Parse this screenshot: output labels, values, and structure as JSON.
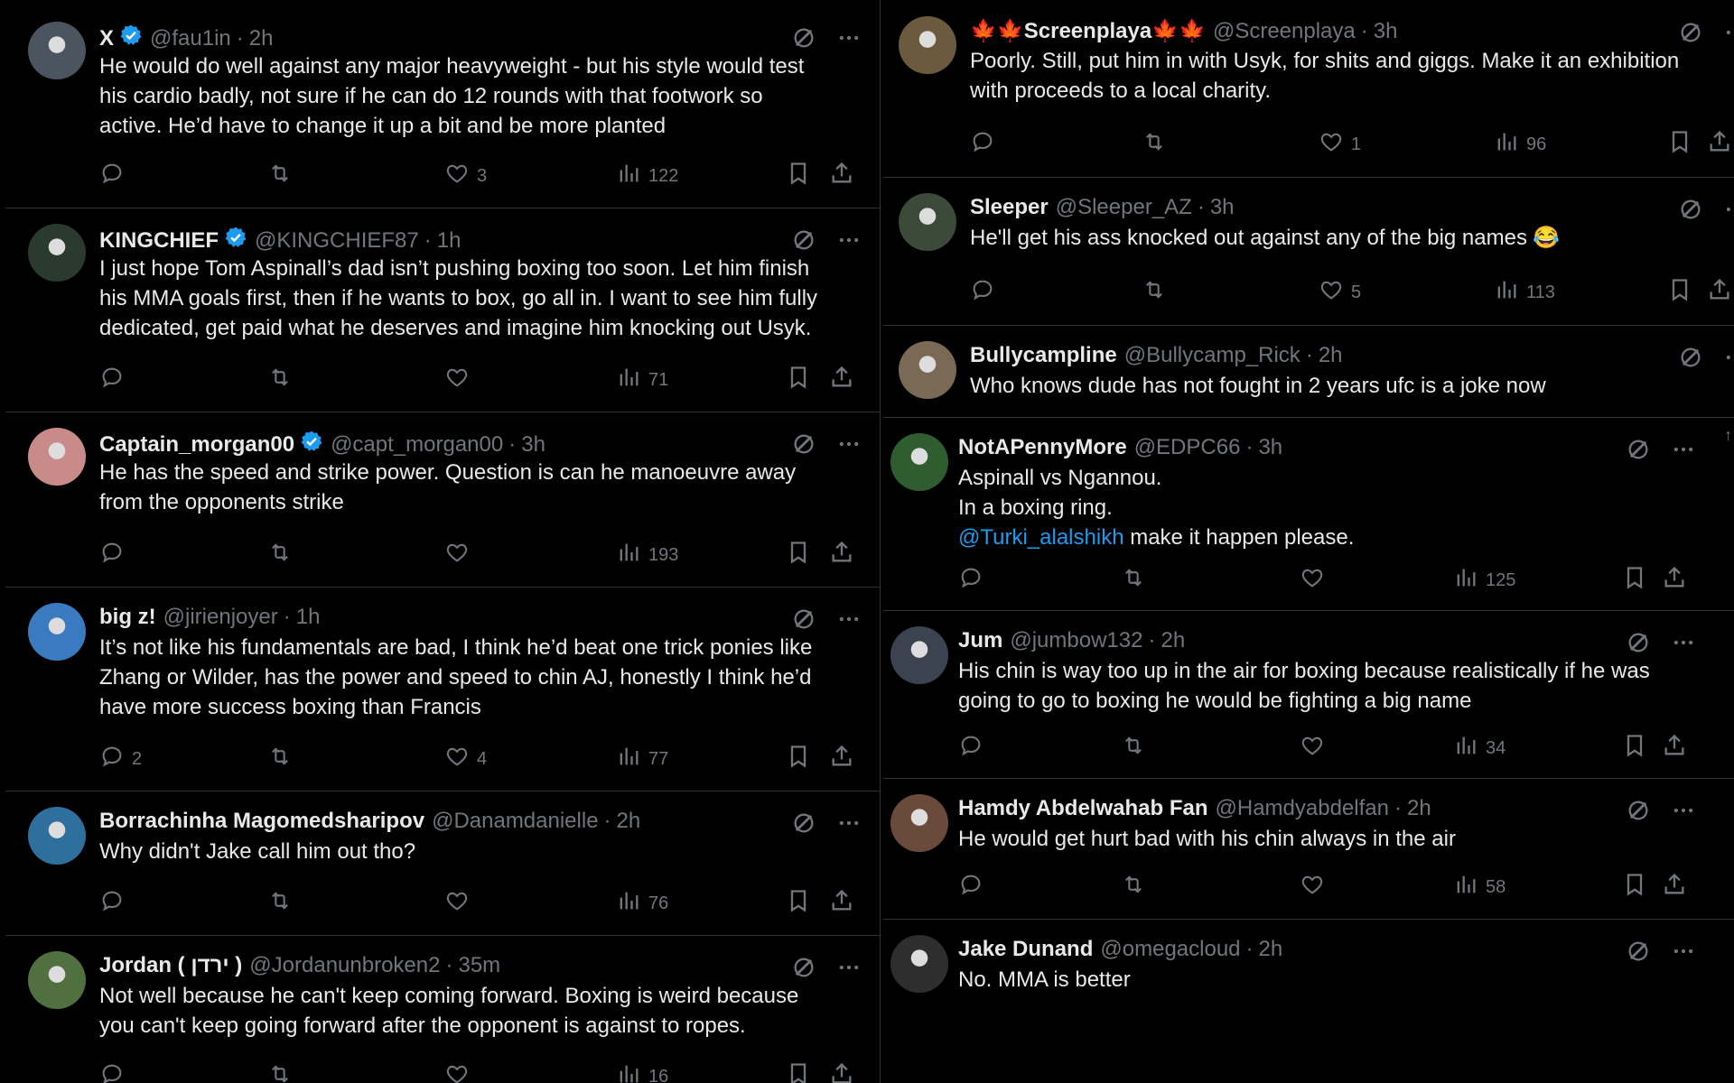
{
  "left": [
    {
      "name": "X",
      "verified": true,
      "handle": "@fau1in",
      "time": "2h",
      "lines": [
        "He would do well against any major heavyweight - but his style would test",
        "his cardio badly, not sure if he can do 12 rounds with that footwork so",
        "active. He’d have to change it up a bit and be more planted"
      ],
      "replies": "",
      "likes": "3",
      "views": "122"
    },
    {
      "name": "KINGCHIEF",
      "verified": true,
      "handle": "@KINGCHIEF87",
      "time": "1h",
      "lines": [
        "I just hope Tom Aspinall’s dad isn’t pushing boxing too soon. Let him finish",
        "his MMA goals first, then if he wants to box, go all in. I want to see him fully",
        "dedicated, get paid what he deserves and imagine him knocking out Usyk."
      ],
      "replies": "",
      "likes": "",
      "views": "71"
    },
    {
      "name": "Captain_morgan00",
      "verified": true,
      "handle": "@capt_morgan00",
      "time": "3h",
      "lines": [
        "He has the speed and strike power. Question is can he manoeuvre away",
        "from the opponents strike"
      ],
      "replies": "",
      "likes": "",
      "views": "193"
    },
    {
      "name": "big z!",
      "verified": false,
      "handle": "@jirienjoyer",
      "time": "1h",
      "lines": [
        "It’s not like his fundamentals are bad, I think he’d beat one trick ponies like",
        "Zhang or Wilder, has the power and speed to chin AJ, honestly I think he’d",
        "have more success boxing than Francis"
      ],
      "replies": "2",
      "likes": "4",
      "views": "77"
    },
    {
      "name": "Borrachinha Magomedsharipov",
      "verified": false,
      "handle": "@Danamdanielle",
      "time": "2h",
      "lines": [
        "Why didn't Jake call him out tho?"
      ],
      "replies": "",
      "likes": "",
      "views": "76"
    },
    {
      "name": "Jordan ( ירדן )",
      "verified": false,
      "handle": "@Jordanunbroken2",
      "time": "35m",
      "lines": [
        "Not well because he can't keep coming forward. Boxing is weird because",
        "you can't keep going forward after the opponent is against to ropes."
      ],
      "replies": "",
      "likes": "",
      "views": "16"
    }
  ],
  "right": [
    {
      "name": "🍁🍁Screenplaya🍁🍁",
      "name_text": "Screenplaya",
      "flags": "🍁",
      "verified": false,
      "handle": "@Screenplaya",
      "time": "3h",
      "lines": [
        "Poorly.  Still, put him in with Usyk, for shits and giggs.  Make it an exhibition",
        "with proceeds to a local charity."
      ],
      "replies": "",
      "likes": "1",
      "views": "96"
    },
    {
      "name": "Sleeper",
      "verified": false,
      "handle": "@Sleeper_AZ",
      "time": "3h",
      "lines": [
        "He'll get his ass knocked out against any of the big names"
      ],
      "emoji": "😂",
      "replies": "",
      "likes": "5",
      "views": "113"
    },
    {
      "name": "Bullycampline",
      "verified": false,
      "handle": "@Bullycamp_Rick",
      "time": "2h",
      "lines": [
        "Who knows dude has not fought in 2 years ufc is a joke now"
      ],
      "replies": "",
      "likes": "",
      "views": ""
    },
    {
      "name": "NotAPennyMore",
      "verified": false,
      "handle": "@EDPC66",
      "time": "3h",
      "lines": [
        "Aspinall vs Ngannou.",
        "In a boxing ring."
      ],
      "mention": "@Turki_alalshikh",
      "mention_rest": " make it happen please.",
      "replies": "",
      "likes": "",
      "views": "125"
    },
    {
      "name": "Jum",
      "verified": false,
      "handle": "@jumbow132",
      "time": "2h",
      "lines": [
        "His chin is way too up in the air for boxing because realistically if he was",
        "going to go to boxing he would be fighting a big name"
      ],
      "replies": "",
      "likes": "",
      "views": "34"
    },
    {
      "name": "Hamdy Abdelwahab Fan",
      "verified": false,
      "handle": "@Hamdyabdelfan",
      "time": "2h",
      "lines": [
        "He would get hurt bad with his chin always in the air"
      ],
      "replies": "",
      "likes": "",
      "views": "58"
    },
    {
      "name": "Jake Dunand",
      "verified": false,
      "handle": "@omegacloud",
      "time": "2h",
      "lines": [
        "No. MMA is better"
      ],
      "replies": "",
      "likes": "",
      "views": ""
    }
  ],
  "icons": {
    "grok": "grok-icon",
    "more": "more-icon",
    "reply": "reply-icon",
    "retweet": "retweet-icon",
    "like": "like-icon",
    "views": "views-icon",
    "bookmark": "bookmark-icon",
    "share": "share-icon"
  },
  "colors": {
    "bg": "#000000",
    "text": "#e7e9ea",
    "muted": "#71767b",
    "link": "#1d9bf0",
    "verified": "#1d9bf0",
    "divider": "#2f3336"
  }
}
